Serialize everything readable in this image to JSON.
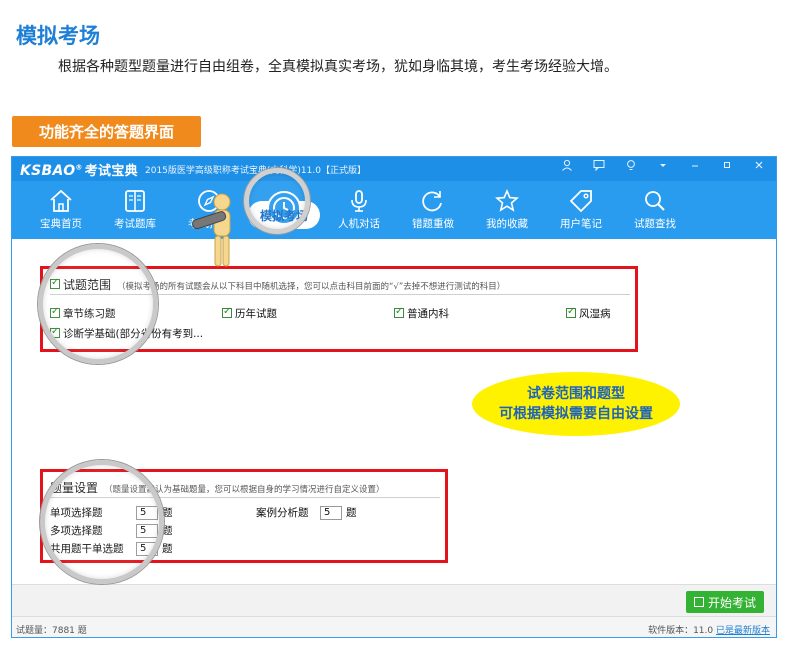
{
  "hero": {
    "title": "模拟考场",
    "description": "根据各种题型题量进行自由组卷，全真模拟真实考场，犹如身临其境，考生考场经验大增。"
  },
  "feature_tag": "功能齐全的答题界面",
  "app": {
    "logo": "KSBAO",
    "logo_mark": "®",
    "logo_cn": "考试宝典",
    "subtitle": "2015版医学高级职称考试宝典(内科学)11.0【正式版】",
    "window_controls": [
      "user-icon",
      "chat-icon",
      "bulb-icon",
      "dropdown-icon",
      "minimize-icon",
      "maximize-icon",
      "close-icon"
    ],
    "nav": [
      {
        "label": "宝典首页",
        "icon": "home-icon"
      },
      {
        "label": "考试题库",
        "icon": "book-icon"
      },
      {
        "label": "考试指南",
        "icon": "compass-icon"
      },
      {
        "label": "模拟考场",
        "icon": "clock-icon",
        "active": true
      },
      {
        "label": "人机对话",
        "icon": "microphone-icon"
      },
      {
        "label": "错题重做",
        "icon": "refresh-icon"
      },
      {
        "label": "我的收藏",
        "icon": "star-icon"
      },
      {
        "label": "用户笔记",
        "icon": "tag-icon"
      },
      {
        "label": "试题查找",
        "icon": "search-icon"
      }
    ],
    "scope": {
      "title": "试题范围",
      "note": "（模拟考场的所有试题会从以下科目中随机选择，您可以点击科目前面的“√”去掉不想进行测试的科目）",
      "items": [
        {
          "label": "章节练习题",
          "checked": true
        },
        {
          "label": "历年试题",
          "checked": true
        },
        {
          "label": "普通内科",
          "checked": true
        },
        {
          "label": "风湿病",
          "checked": true
        },
        {
          "label": "诊断学基础(部分省份有考到...",
          "checked": true
        }
      ]
    },
    "quantity": {
      "title": "题量设置",
      "note": "（题量设置默认为基础题量，您可以根据自身的学习情况进行自定义设置）",
      "rows": [
        {
          "label": "单项选择题",
          "value": "5",
          "unit": "题"
        },
        {
          "label": "多项选择题",
          "value": "5",
          "unit": "题"
        },
        {
          "label": "共用题干单选题",
          "value": "5",
          "unit": "题"
        },
        {
          "label": "案例分析题",
          "value": "5",
          "unit": "题"
        }
      ]
    },
    "callout": {
      "line1": "试卷范围和题型",
      "line2": "可根据模拟需要自由设置"
    },
    "start_button": "开始考试",
    "status": {
      "question_count": "试题量：7881 题",
      "version": "软件版本：11.0",
      "latest_link": "已是最新版本"
    },
    "colors": {
      "titlebar": "#1e8fe6",
      "navbar": "#2a9cf0",
      "highlight_box": "#e3131b",
      "tag": "#f08a1c",
      "callout": "#fff200",
      "start_button": "#33b233"
    }
  }
}
